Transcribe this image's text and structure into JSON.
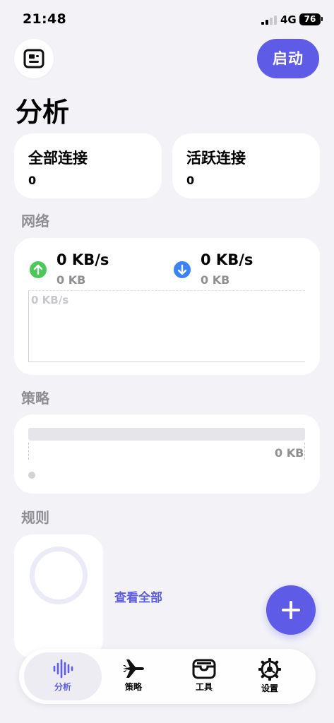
{
  "status_bar": {
    "time": "21:48",
    "network": "4G",
    "battery": "76"
  },
  "header": {
    "start_label": "启动",
    "title": "分析"
  },
  "stats": {
    "all_connections": {
      "label": "全部连接",
      "value": "0"
    },
    "active_connections": {
      "label": "活跃连接",
      "value": "0"
    }
  },
  "network": {
    "section_label": "网络",
    "upload": {
      "speed": "0 KB/s",
      "total": "0 KB"
    },
    "download": {
      "speed": "0 KB/s",
      "total": "0 KB"
    },
    "chart_label": "0 KB/s",
    "colors": {
      "upload": "#4cc85a",
      "download": "#3a82f7"
    }
  },
  "policy": {
    "section_label": "策略",
    "value": "0 KB"
  },
  "rules": {
    "section_label": "规则",
    "view_all": "查看全部"
  },
  "tabs": [
    {
      "label": "分析",
      "icon": "waveform-icon",
      "active": true
    },
    {
      "label": "策略",
      "icon": "airplane-icon",
      "active": false
    },
    {
      "label": "工具",
      "icon": "toolbox-icon",
      "active": false
    },
    {
      "label": "设置",
      "icon": "gear-icon",
      "active": false
    }
  ],
  "accent_color": "#5e5ce6"
}
